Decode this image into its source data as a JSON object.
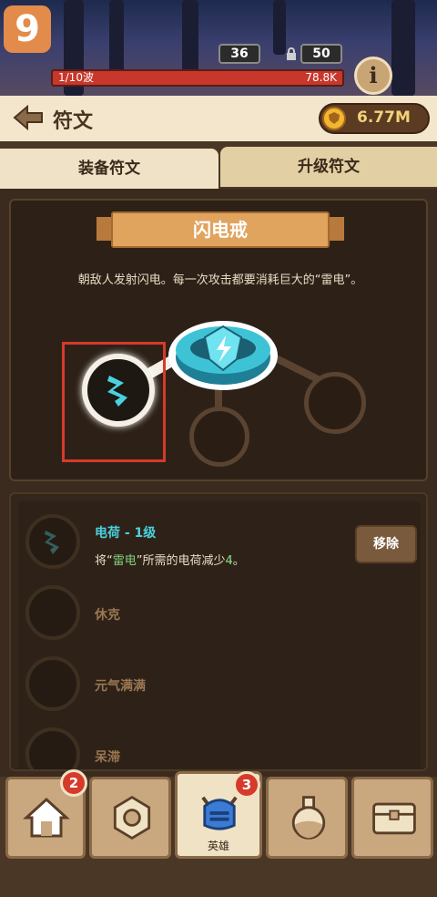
{
  "hud": {
    "step_number": "9",
    "counter_a": "36",
    "counter_b": "50",
    "wave_label": "1/10波",
    "wave_hp": "78.8K",
    "info_label": "i"
  },
  "header": {
    "title": "符文",
    "coins": "6.77M"
  },
  "tabs": [
    {
      "label": "装备符文",
      "active": true
    },
    {
      "label": "升级符文",
      "active": false
    }
  ],
  "rune": {
    "name": "闪电戒",
    "description": "朝敌人发射闪电。每一次攻击都要消耗巨大的“雷电”。"
  },
  "rune_list": [
    {
      "name": "电荷 - 1级",
      "effect_prefix": "将“",
      "effect_keyword": "雷电",
      "effect_middle": "”所需的电荷减少",
      "effect_value": "4",
      "effect_suffix": "。",
      "action": "移除"
    },
    {
      "name": "休克"
    },
    {
      "name": "元气满满"
    },
    {
      "name": "呆滞"
    }
  ],
  "nav": {
    "home_badge": "2",
    "hero_badge": "3",
    "hero_label": "英雄"
  },
  "colors": {
    "accent_cyan": "#4bd1df",
    "highlight_red": "#d63a2b",
    "coin_gold": "#f2b632"
  }
}
